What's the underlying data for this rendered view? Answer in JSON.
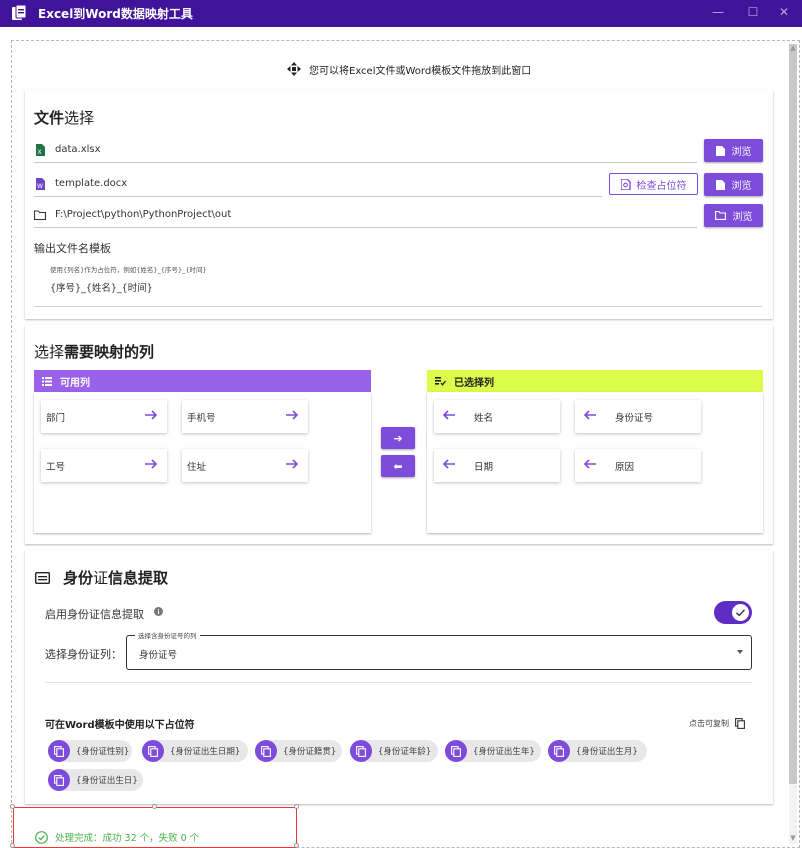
{
  "app": {
    "title": "Excel到Word数据映射工具",
    "title_bar_color": "#3f139a",
    "accent": "#7d4cdb"
  },
  "window_controls": {
    "minimize": "—",
    "maximize": "☐",
    "close": "✕"
  },
  "drop_hint": "您可以将Excel文件或Word模板文件拖放到此窗口",
  "file_section": {
    "title_bold": "文件",
    "title_rest": "选择",
    "excel_path": "data.xlsx",
    "word_path": "template.docx",
    "output_path": "F:\\Project\\python\\PythonProject\\out",
    "browse_label": "浏览",
    "check_placeholder_label": "检查占位符",
    "template_label": "输出文件名模板",
    "template_hint": "使用{列名}作为占位符，例如{姓名}_{序号}_{时间}",
    "template_value": "{序号}_{姓名}_{时间}"
  },
  "column_section": {
    "title_prefix": "选择",
    "title_bold": "需要映射的列",
    "available_label": "可用列",
    "selected_label": "已选择列",
    "available_color": "#9a62ea",
    "selected_color": "#dcfb4b",
    "available_columns": [
      "部门",
      "手机号",
      "工号",
      "住址"
    ],
    "selected_columns": [
      "姓名",
      "身份证号",
      "日期",
      "原因"
    ],
    "move_right_glyph": "➜",
    "move_left_glyph": "⬅"
  },
  "id_section": {
    "title_a": "身份",
    "title_b": "证",
    "title_c": "信息提取",
    "enable_label": "启用身份证信息提取",
    "enable_on": true,
    "select_label": "选择身份证列：",
    "select_floating_label": "选择含身份证号的列",
    "select_value": "身份证号",
    "placeholder_title": "可在Word模板中使用以下占位符",
    "copy_hint": "点击可复制",
    "placeholders": [
      "{身份证性别}",
      "{身份证出生日期}",
      "{身份证籍贯}",
      "{身份证年龄}",
      "{身份证出生年}",
      "{身份证出生月}",
      "{身份证出生日}"
    ]
  },
  "status": {
    "text": "处理完成：成功 32 个，失败 0 个",
    "color": "#4caf50"
  }
}
